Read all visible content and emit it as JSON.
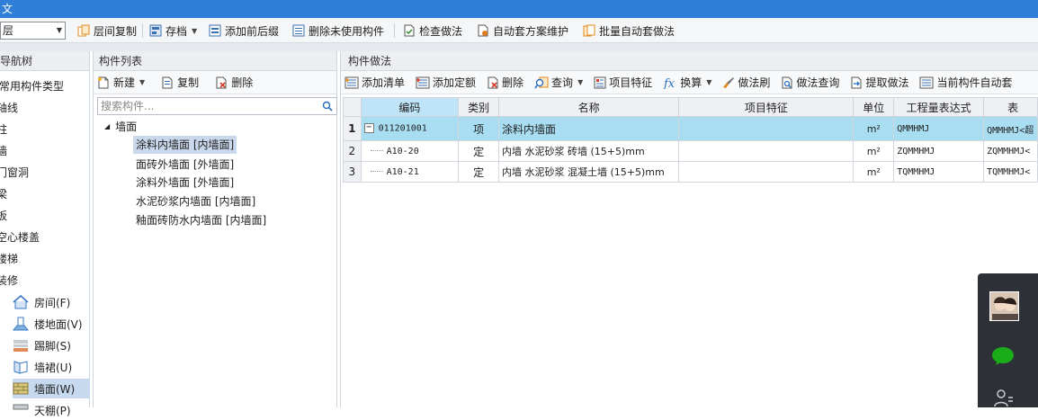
{
  "titlebar": {
    "text": "文"
  },
  "toolbar": {
    "floor_select": "层",
    "items": [
      "层间复制",
      "存档",
      "添加前后缀",
      "删除未使用构件",
      "检查做法",
      "自动套方案维护",
      "批量自动套做法"
    ]
  },
  "nav_tree": {
    "header": "导航树",
    "items": [
      "常用构件类型",
      "轴线",
      "柱",
      "墙",
      "门窗洞",
      "梁",
      "板",
      "空心楼盖",
      "楼梯",
      "装修"
    ],
    "sub_items": [
      "房间(F)",
      "楼地面(V)",
      "踢脚(S)",
      "墙裙(U)",
      "墙面(W)",
      "天棚(P)"
    ]
  },
  "component_list": {
    "header": "构件列表",
    "actions": {
      "new": "新建",
      "copy": "复制",
      "delete": "删除"
    },
    "search_placeholder": "搜索构件...",
    "group": "墙面",
    "items": [
      "涂料内墙面 [内墙面]",
      "面砖外墙面 [外墙面]",
      "涂料外墙面 [外墙面]",
      "水泥砂浆内墙面 [内墙面]",
      "釉面砖防水内墙面 [内墙面]"
    ]
  },
  "method": {
    "header": "构件做法",
    "actions": [
      "添加清单",
      "添加定额",
      "删除",
      "查询",
      "项目特征",
      "换算",
      "做法刷",
      "做法查询",
      "提取做法",
      "当前构件自动套"
    ],
    "columns": [
      "编码",
      "类别",
      "名称",
      "项目特征",
      "单位",
      "工程量表达式",
      "表"
    ],
    "rows": [
      {
        "n": "1",
        "code": "011201001",
        "type": "项",
        "name": "涂料内墙面",
        "feature": "",
        "unit": "m²",
        "expr": "QMMHMJ",
        "expr2": "QMMHMJ<超"
      },
      {
        "n": "2",
        "code": "A10-20",
        "type": "定",
        "name": "内墙 水泥砂浆 砖墙 (15+5)mm",
        "feature": "",
        "unit": "m²",
        "expr": "ZQMMHMJ",
        "expr2": "ZQMMHMJ<"
      },
      {
        "n": "3",
        "code": "A10-21",
        "type": "定",
        "name": "内墙 水泥砂浆 混凝土墙 (15+5)mm",
        "feature": "",
        "unit": "m²",
        "expr": "TQMMHMJ",
        "expr2": "TQMMHMJ<"
      }
    ]
  },
  "colors": {
    "accent": "#2f7fd8",
    "selected_row": "#a8ddf2",
    "selected_item": "#c7d9ef",
    "chat_green": "#1aad19"
  }
}
